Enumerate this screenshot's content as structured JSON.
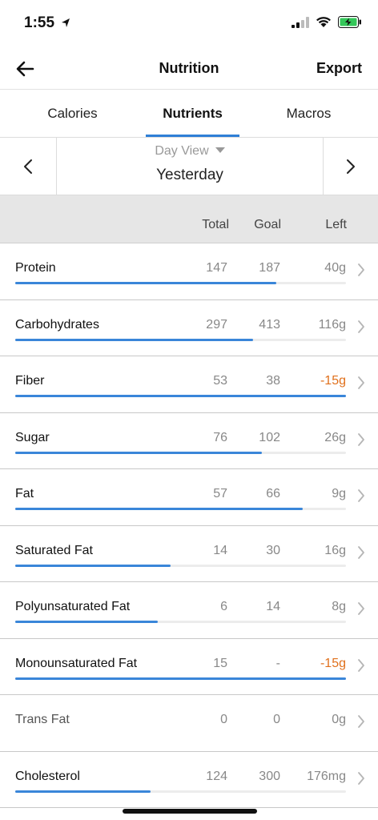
{
  "status": {
    "time": "1:55"
  },
  "nav": {
    "title": "Nutrition",
    "export_label": "Export"
  },
  "tabs": [
    {
      "label": "Calories",
      "active": false
    },
    {
      "label": "Nutrients",
      "active": true
    },
    {
      "label": "Macros",
      "active": false
    }
  ],
  "date": {
    "view_label": "Day View",
    "label": "Yesterday"
  },
  "columns": {
    "total": "Total",
    "goal": "Goal",
    "left": "Left"
  },
  "colors": {
    "accent": "#3a86d9",
    "over": "#e0701c"
  },
  "nutrients": [
    {
      "name": "Protein",
      "total": "147",
      "goal": "187",
      "left": "40g",
      "progress": 0.79,
      "over": false,
      "muted": false
    },
    {
      "name": "Carbohydrates",
      "total": "297",
      "goal": "413",
      "left": "116g",
      "progress": 0.72,
      "over": false,
      "muted": false
    },
    {
      "name": "Fiber",
      "total": "53",
      "goal": "38",
      "left": "-15g",
      "progress": 1.0,
      "over": true,
      "muted": false
    },
    {
      "name": "Sugar",
      "total": "76",
      "goal": "102",
      "left": "26g",
      "progress": 0.745,
      "over": false,
      "muted": false
    },
    {
      "name": "Fat",
      "total": "57",
      "goal": "66",
      "left": "9g",
      "progress": 0.87,
      "over": false,
      "muted": false
    },
    {
      "name": "Saturated Fat",
      "total": "14",
      "goal": "30",
      "left": "16g",
      "progress": 0.47,
      "over": false,
      "muted": false
    },
    {
      "name": "Polyunsaturated Fat",
      "total": "6",
      "goal": "14",
      "left": "8g",
      "progress": 0.43,
      "over": false,
      "muted": false
    },
    {
      "name": "Monounsaturated Fat",
      "total": "15",
      "goal": "-",
      "left": "-15g",
      "progress": 1.0,
      "over": true,
      "muted": false
    },
    {
      "name": "Trans Fat",
      "total": "0",
      "goal": "0",
      "left": "0g",
      "progress": 0,
      "over": false,
      "muted": true
    },
    {
      "name": "Cholesterol",
      "total": "124",
      "goal": "300",
      "left": "176mg",
      "progress": 0.41,
      "over": false,
      "muted": false
    }
  ]
}
